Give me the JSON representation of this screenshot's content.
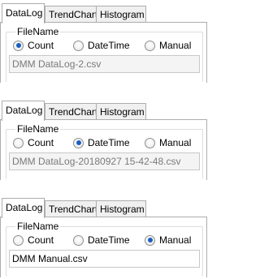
{
  "panels": [
    {
      "tabs": [
        "DataLog",
        "TrendChart",
        "Histogram"
      ],
      "active_tab": "DataLog",
      "group_title": "FileName",
      "radios": [
        "Count",
        "DateTime",
        "Manual"
      ],
      "selected": "Count",
      "filename": "DMM DataLog-2.csv",
      "filename_editable": false
    },
    {
      "tabs": [
        "DataLog",
        "TrendChart",
        "Histogram"
      ],
      "active_tab": "DataLog",
      "group_title": "FileName",
      "radios": [
        "Count",
        "DateTime",
        "Manual"
      ],
      "selected": "DateTime",
      "filename": "DMM DataLog-20180927 15-42-48.csv",
      "filename_editable": false
    },
    {
      "tabs": [
        "DataLog",
        "TrendChart",
        "Histogram"
      ],
      "active_tab": "DataLog",
      "group_title": "FileName",
      "radios": [
        "Count",
        "DateTime",
        "Manual"
      ],
      "selected": "Manual",
      "filename": "DMM Manual.csv",
      "filename_editable": true
    }
  ],
  "colors": {
    "radio_dot": "#1a5fbf",
    "border": "#adadad",
    "disabled_text": "#7a7a7a"
  }
}
